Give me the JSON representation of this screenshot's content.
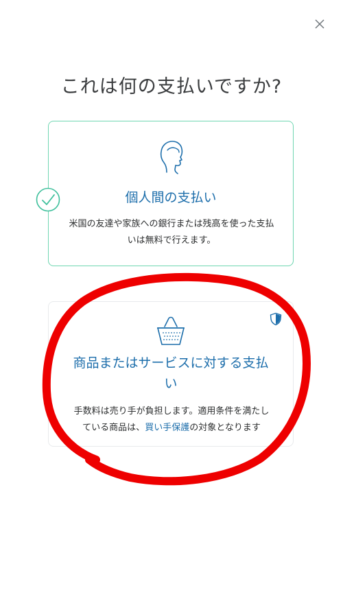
{
  "header": {
    "close_icon": "close-icon",
    "title": "これは何の支払いですか?"
  },
  "cards": {
    "personal": {
      "icon": "person-head-icon",
      "title": "個人間の支払い",
      "description": "米国の友達や家族への銀行または残高を使った支払いは無料で行えます。",
      "selected": true
    },
    "goods": {
      "icon": "shopping-basket-icon",
      "badge_icon": "shield-icon",
      "title_line1": "商品またはサービスに対する支払",
      "title_line2": "い",
      "description_line1": "手数料は売り手が負担します。適用条件を満たし",
      "description_prefix": "ている商品は、",
      "link_text": "買い手保護",
      "description_suffix": "の対象となります"
    }
  },
  "colors": {
    "selected_border": "#6fd6b1",
    "check_color": "#3dbf9b",
    "accent_blue": "#1d6eab",
    "annotation_red": "#ee0000"
  },
  "annotation": {
    "type": "hand-drawn-circle",
    "color": "red",
    "target": "goods"
  }
}
